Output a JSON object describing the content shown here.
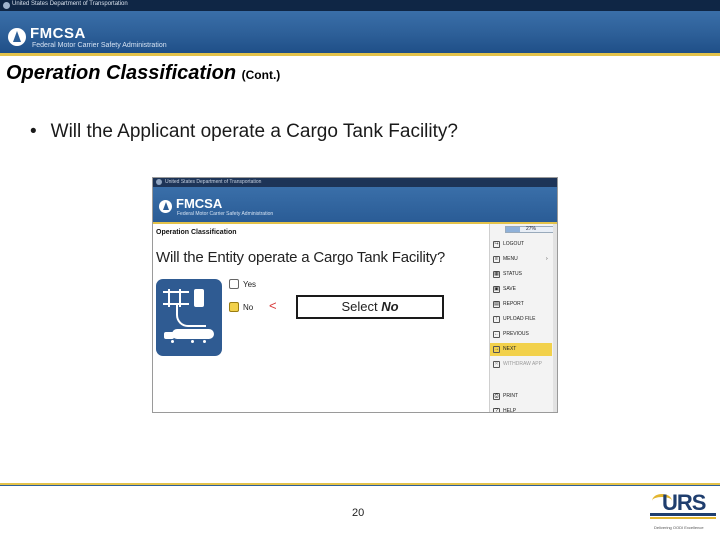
{
  "header": {
    "department": "United States Department of Transportation",
    "brand": "FMCSA",
    "brand_subtitle": "Federal Motor Carrier Safety Administration"
  },
  "slide": {
    "title": "Operation Classification",
    "title_suffix": "(Cont.)",
    "bullet": "Will the Applicant operate a Cargo Tank Facility?",
    "page_number": "20"
  },
  "screenshot": {
    "department": "United States Department of Transportation",
    "brand": "FMCSA",
    "brand_subtitle": "Federal Motor Carrier Safety Administration",
    "section_heading": "Operation Classification",
    "question": "Will the Entity operate a Cargo Tank Facility?",
    "options": [
      {
        "label": "Yes",
        "selected": false
      },
      {
        "label": "No",
        "selected": true
      }
    ],
    "arrow": "<",
    "callout_prefix": "Select",
    "callout_value": "No",
    "progress": {
      "percent": 27,
      "label": "27%"
    },
    "sidebar": [
      {
        "label": "LOGOUT",
        "icon": "logout-icon",
        "glyph": "↪"
      },
      {
        "label": "MENU",
        "icon": "menu-icon",
        "glyph": "≡",
        "chevron": "›"
      },
      {
        "label": "STATUS",
        "icon": "status-icon",
        "glyph": "▦"
      },
      {
        "label": "SAVE",
        "icon": "save-icon",
        "glyph": "▣"
      },
      {
        "label": "REPORT",
        "icon": "report-icon",
        "glyph": "▤"
      },
      {
        "label": "UPLOAD FILE",
        "icon": "upload-icon",
        "glyph": "↑"
      },
      {
        "label": "PREVIOUS",
        "icon": "previous-icon",
        "glyph": "←"
      },
      {
        "label": "NEXT",
        "icon": "next-icon",
        "glyph": "→",
        "highlighted": true
      },
      {
        "label": "WITHDRAW APP",
        "icon": "withdraw-icon",
        "glyph": "✕",
        "disabled": true
      },
      {
        "label": "PRINT",
        "icon": "print-icon",
        "glyph": "⎙"
      },
      {
        "label": "HELP",
        "icon": "help-icon",
        "glyph": "?"
      }
    ]
  },
  "footer": {
    "logo_text": "URS",
    "logo_tagline": "Delivering OODI Excellence"
  },
  "colors": {
    "navy": "#0f2645",
    "brand_blue": "#2d5f98",
    "gold": "#e3c24a",
    "highlight": "#f2d14b",
    "arrow_red": "#d83a3a"
  }
}
